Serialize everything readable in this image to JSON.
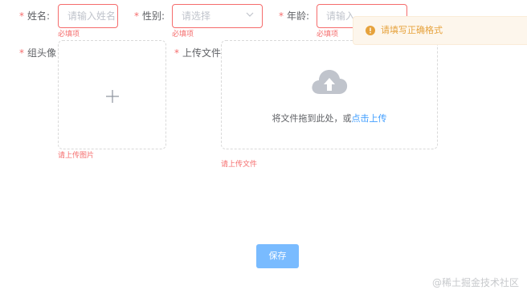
{
  "form": {
    "name": {
      "label": "姓名:",
      "placeholder": "请输入姓名",
      "error": "必填项"
    },
    "gender": {
      "label": "性别:",
      "placeholder": "请选择",
      "error": "必填项"
    },
    "age": {
      "label": "年龄:",
      "placeholder": "请输入",
      "error": "必填项"
    },
    "avatar": {
      "label": "组头像",
      "error": "请上传图片"
    },
    "file": {
      "label": "上传文件",
      "hint_prefix": "将文件拖到此处，或",
      "hint_link": "点击上传",
      "error": "请上传文件"
    },
    "required_mark": "*"
  },
  "toast": {
    "message": "请填写正确格式",
    "type": "warning"
  },
  "actions": {
    "save_label": "保存"
  },
  "watermark": "@稀土掘金技术社区",
  "colors": {
    "error": "#f56c6c",
    "warning": "#e6a23c",
    "warning_bg": "#fdf6ec",
    "primary": "#409eff",
    "button_disabled": "#79bbff",
    "label": "#606266",
    "placeholder": "#c0c4cc",
    "icon_gray": "#c0c4cc"
  }
}
